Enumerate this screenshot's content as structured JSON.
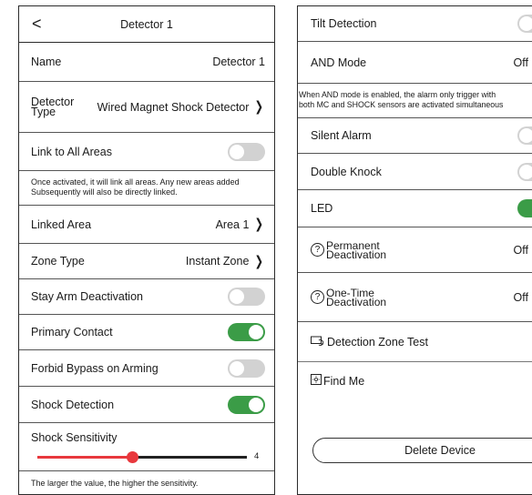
{
  "header": {
    "back_glyph": "<",
    "title": "Detector 1"
  },
  "left": {
    "name": {
      "label": "Name",
      "value": "Detector 1"
    },
    "detector_type": {
      "label_line1": "Detector",
      "label_line2": "Type",
      "value": "Wired Magnet Shock Detector"
    },
    "link_all": {
      "label": "Link to All Areas",
      "on": false
    },
    "link_note_line1": "Once activated, it will link all areas. Any new areas added",
    "link_note_line2": "Subsequently will also be directly linked.",
    "linked_area": {
      "label": "Linked Area",
      "value": "Area 1"
    },
    "zone_type": {
      "label": "Zone Type",
      "value": "Instant Zone"
    },
    "stay_arm": {
      "label": "Stay Arm Deactivation",
      "on": false
    },
    "primary_contact": {
      "label": "Primary Contact",
      "on": true
    },
    "forbid_bypass": {
      "label": "Forbid Bypass on Arming",
      "on": false
    },
    "shock_detection": {
      "label": "Shock Detection",
      "on": true
    },
    "shock_sensitivity": {
      "label": "Shock Sensitivity",
      "value": "4",
      "level": 0.45
    },
    "sensitivity_note": "The larger the value, the higher the sensitivity."
  },
  "right": {
    "tilt_detection": {
      "label": "Tilt Detection",
      "on": false
    },
    "and_mode": {
      "label": "AND Mode",
      "value": "Off"
    },
    "and_note_line1": "When AND mode is enabled, the alarm only trigger with",
    "and_note_line2": "both MC and SHOCK sensors are activated simultaneous",
    "silent_alarm": {
      "label": "Silent Alarm",
      "on": false
    },
    "double_knock": {
      "label": "Double Knock",
      "on": false
    },
    "led": {
      "label": "LED",
      "on": true
    },
    "permanent_deactivation": {
      "line1": "Permanent",
      "line2": "Deactivation",
      "value": "Off",
      "icon": "?"
    },
    "one_time_deactivation": {
      "line1": "One-Time",
      "line2": "Deactivation",
      "value": "Off",
      "icon": "?"
    },
    "detection_zone_test": {
      "label": "Detection Zone Test"
    },
    "find_me": {
      "label": "Find Me"
    },
    "delete_button": "Delete Device"
  },
  "colors": {
    "toggle_on": "#3b9c47",
    "toggle_off": "#d2d2d2",
    "slider": "#e8383d"
  },
  "chevron_glyph": "❯"
}
